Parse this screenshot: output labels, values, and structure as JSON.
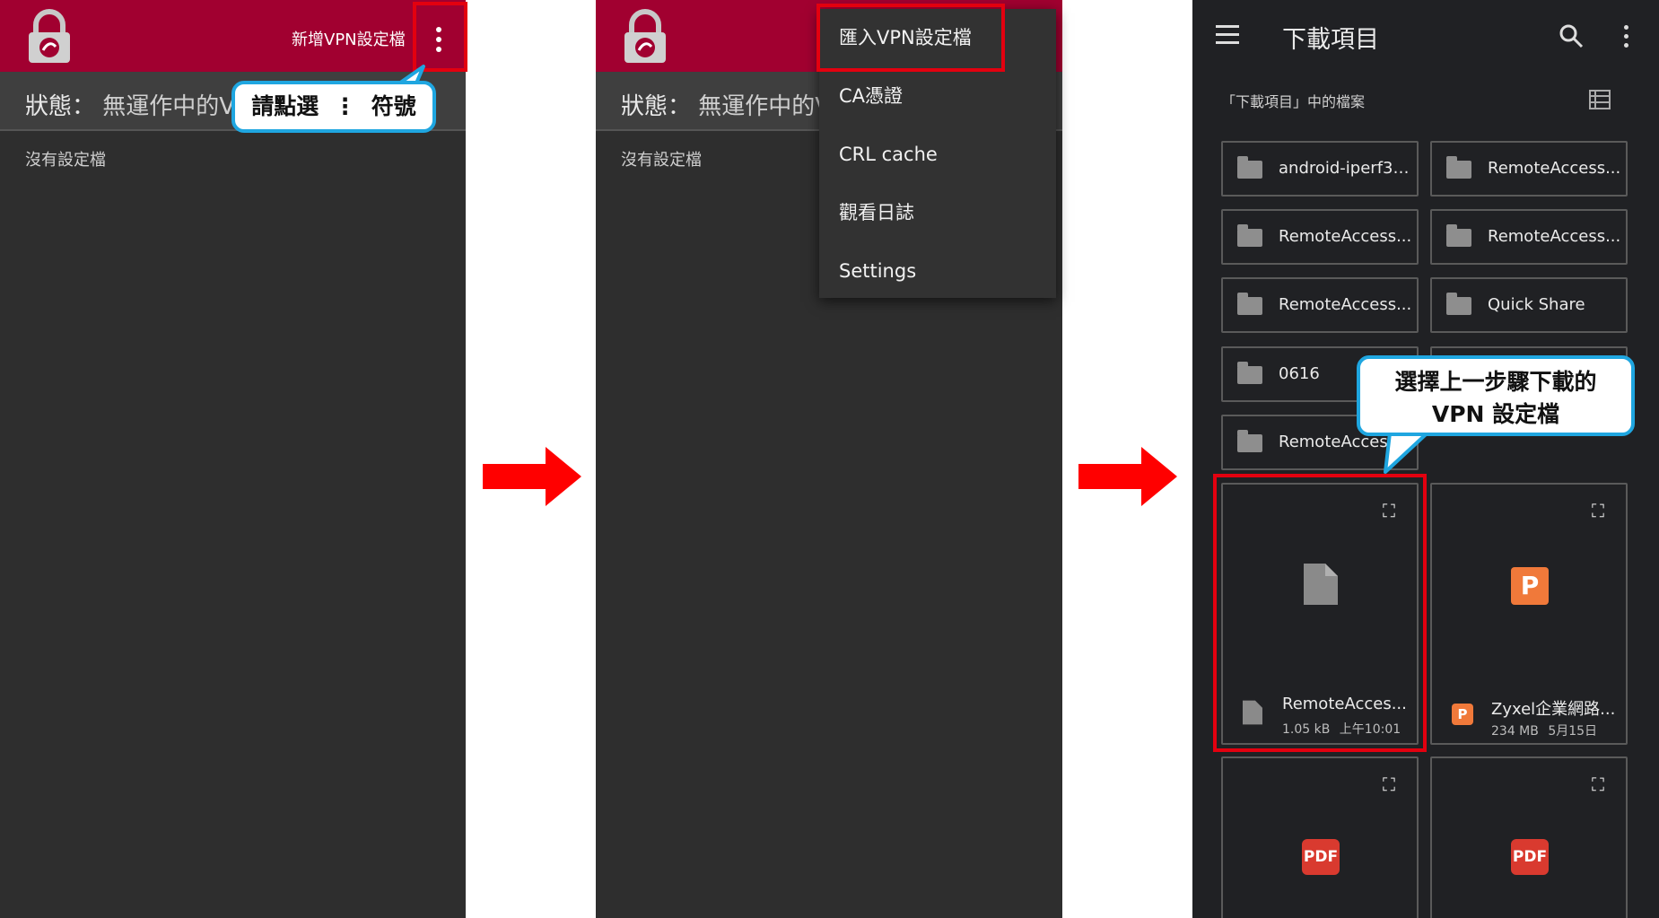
{
  "panel1": {
    "add_profile": "新增VPN設定檔",
    "status_label": "狀態：",
    "status_value": "無運作中的V",
    "no_profile": "沒有設定檔",
    "callout_left": "請點選",
    "callout_symbol": "⋮",
    "callout_right": "符號"
  },
  "panel2": {
    "status_label": "狀態：",
    "status_value": "無運作中的V",
    "no_profile": "沒有設定檔",
    "menu": [
      "匯入VPN設定檔",
      "CA憑證",
      "CRL cache",
      "觀看日誌",
      "Settings"
    ]
  },
  "panel3": {
    "title": "下載項目",
    "section": "「下載項目」中的檔案",
    "folders": [
      "android-iperf3-...",
      "RemoteAccess...",
      "RemoteAccess...",
      "RemoteAccess...",
      "RemoteAccess...",
      "Quick Share",
      "0616",
      "",
      "RemoteAccess"
    ],
    "file1": {
      "name": "RemoteAcces...",
      "size": "1.05 kB",
      "time": "上午10:01"
    },
    "file2": {
      "name": "Zyxel企業網路...",
      "size": "234 MB",
      "time": "5月15日",
      "badge": "P"
    },
    "pdf_label": "PDF",
    "callout_line1": "選擇上一步驟下載的",
    "callout_line2": "VPN 設定檔"
  },
  "colors": {
    "appbar": "#a10030",
    "highlight": "#e3000f",
    "callout_border": "#1fa6e0",
    "arrow": "#ff0000"
  }
}
